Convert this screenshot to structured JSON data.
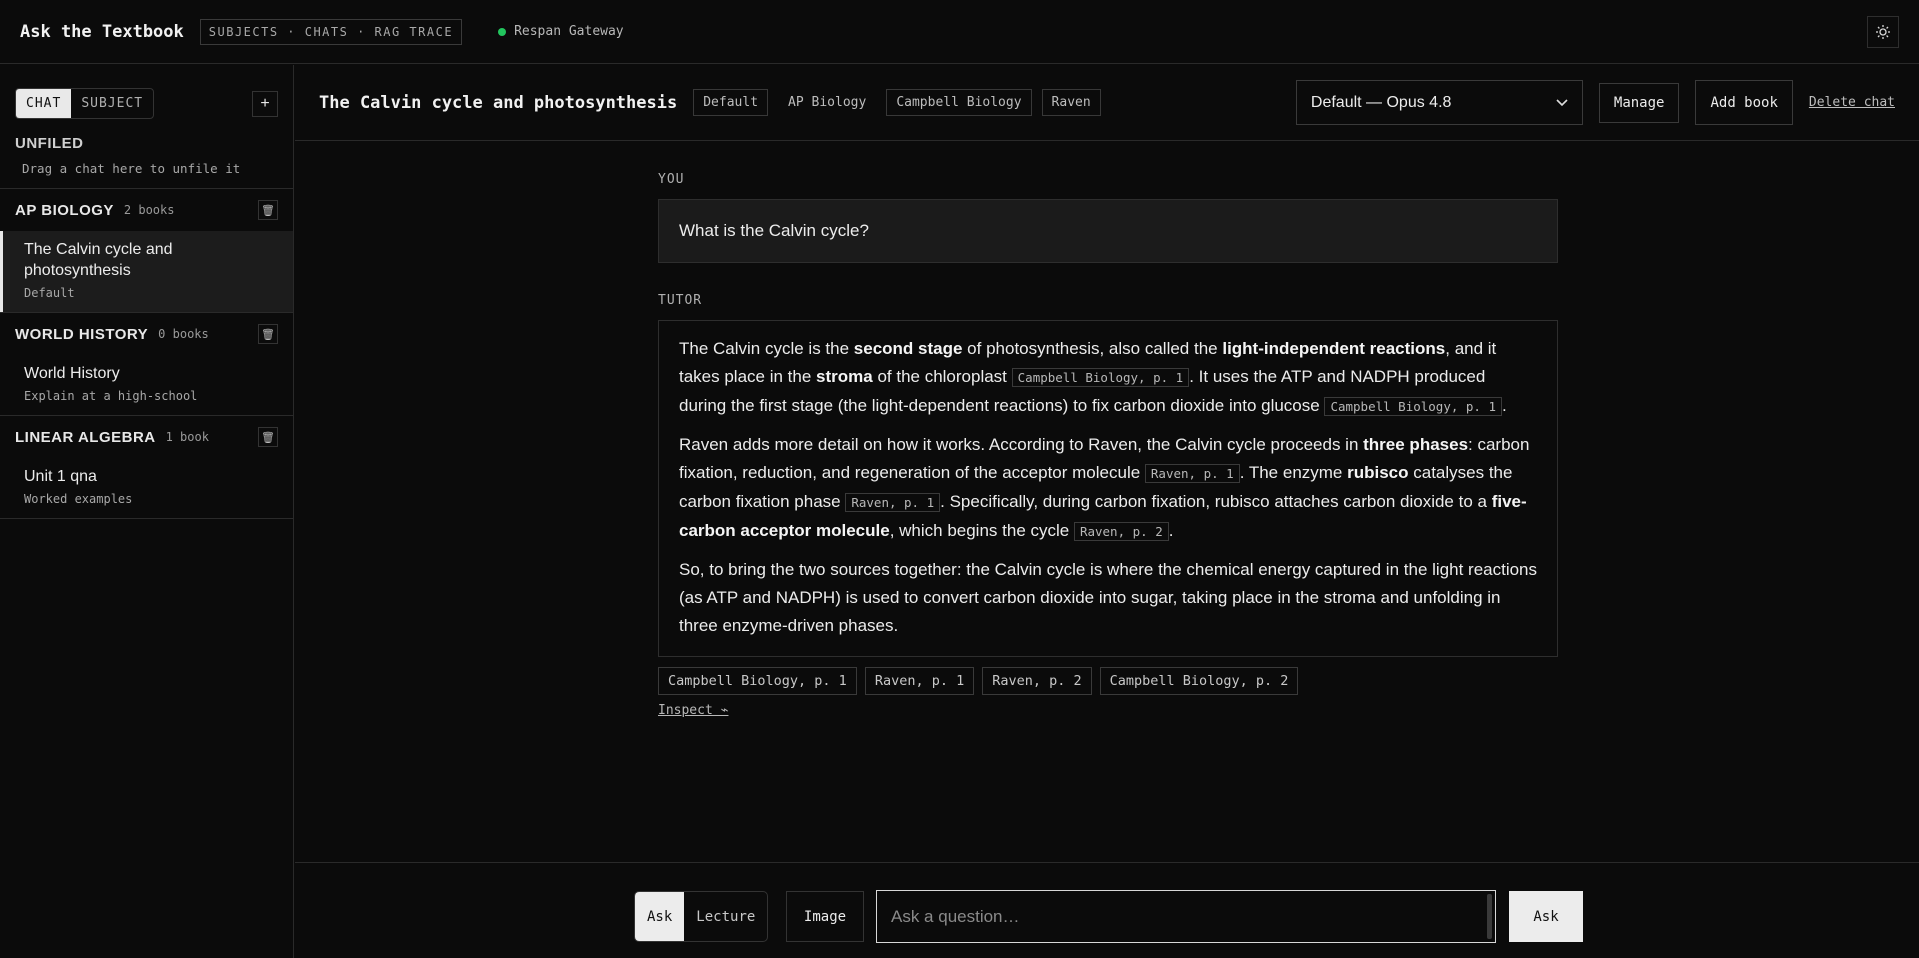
{
  "app": {
    "title": "Ask the Textbook",
    "nav": "SUBJECTS · CHATS · RAG TRACE",
    "gateway_label": "Respan Gateway",
    "theme_icon": "sun-icon"
  },
  "sidebar": {
    "toggle": [
      "CHAT",
      "SUBJECT"
    ],
    "new_label": "+",
    "unfiled": {
      "title": "UNFILED",
      "hint": "Drag a chat here to unfile it"
    },
    "groups": [
      {
        "name": "AP BIOLOGY",
        "count": "2 books",
        "chats": [
          {
            "title": "The Calvin cycle and photosynthesis",
            "subtitle": "Default"
          }
        ]
      },
      {
        "name": "WORLD HISTORY",
        "count": "0 books",
        "chats": [
          {
            "title": "World History",
            "subtitle": "Explain at a high-school"
          }
        ]
      },
      {
        "name": "LINEAR ALGEBRA",
        "count": "1 book",
        "chats": [
          {
            "title": "Unit 1 qna",
            "subtitle": "Worked examples"
          }
        ]
      }
    ]
  },
  "header": {
    "chat_title": "The Calvin cycle and photosynthesis",
    "tags": [
      "Default",
      "AP Biology",
      "Campbell Biology",
      "Raven"
    ],
    "model_select": "Default — Opus 4.8",
    "manage_label": "Manage",
    "add_book_label": "Add book",
    "delete_label": "Delete chat"
  },
  "conversation": {
    "you_label": "YOU",
    "question": "What is the Calvin cycle?",
    "tutor_label": "TUTOR",
    "answer": {
      "p1": {
        "t1": "The Calvin cycle is the ",
        "b1": "second stage",
        "t2": " of photosynthesis, also called the ",
        "b2": "light-independent reactions",
        "t3": ", and it takes place in the ",
        "b3": "stroma",
        "t4": " of the chloroplast ",
        "c1": "Campbell Biology, p. 1",
        "t5": ". It uses the ATP and NADPH produced during the first stage (the light-dependent reactions) to fix carbon dioxide into glucose ",
        "c2": "Campbell Biology, p. 1",
        "t6": "."
      },
      "p2": {
        "t1": "Raven adds more detail on how it works. According to Raven, the Calvin cycle proceeds in ",
        "b1": "three phases",
        "t2": ": carbon fixation, reduction, and regeneration of the acceptor molecule ",
        "c1": "Raven, p. 1",
        "t3": ". The enzyme ",
        "b2": "rubisco",
        "t4": " catalyses the carbon fixation phase ",
        "c2": "Raven, p. 1",
        "t5": ". Specifically, during carbon fixation, rubisco attaches carbon dioxide to a ",
        "b3": "five-carbon acceptor molecule",
        "t6": ", which begins the cycle ",
        "c3": "Raven, p. 2",
        "t7": "."
      },
      "p3": "So, to bring the two sources together: the Calvin cycle is where the chemical energy captured in the light reactions (as ATP and NADPH) is used to convert carbon dioxide into sugar, taking place in the stroma and unfolding in three enzyme-driven phases."
    },
    "sources": [
      "Campbell Biology, p. 1",
      "Raven, p. 1",
      "Raven, p. 2",
      "Campbell Biology, p. 2"
    ],
    "inspect_label": "Inspect ⌁"
  },
  "composer": {
    "modes": [
      "Ask",
      "Lecture"
    ],
    "image_label": "Image",
    "placeholder": "Ask a question…",
    "ask_label": "Ask"
  }
}
